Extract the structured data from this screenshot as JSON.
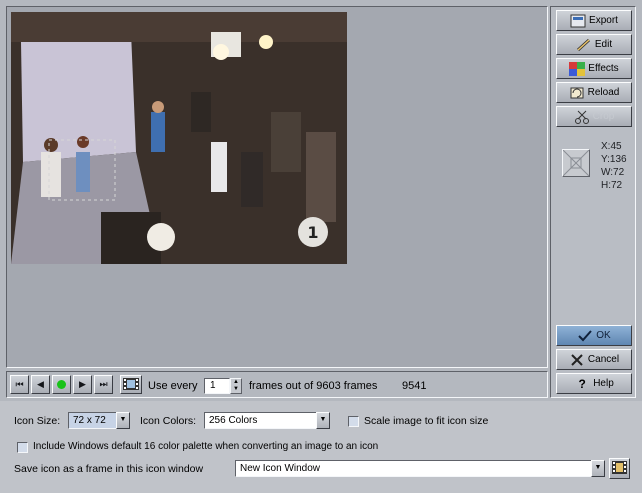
{
  "side_buttons": {
    "export": "Export",
    "edit": "Edit",
    "effects": "Effects",
    "reload": "Reload",
    "crop": "Crop",
    "ok": "OK",
    "cancel": "Cancel",
    "help": "Help"
  },
  "selection": {
    "x": "X:45",
    "y": "Y:136",
    "w": "W:72",
    "h": "H:72"
  },
  "transport": {
    "use_every_label": "Use every",
    "every_value": "1",
    "frames_label": "frames out of 9603 frames",
    "current_frame": "9541"
  },
  "options": {
    "icon_size_label": "Icon Size:",
    "icon_size_value": "72 x 72",
    "icon_colors_label": "Icon Colors:",
    "icon_colors_value": "256 Colors",
    "scale_label": "Scale image to fit icon size",
    "palette_label": "Include Windows default 16 color palette when converting an image to an icon",
    "save_label": "Save icon as a frame in this icon window",
    "save_target": "New Icon Window"
  },
  "video_watermark": "1",
  "colors": {
    "accent_ok": "#6f93bd",
    "panel": "#a4a8b0"
  }
}
